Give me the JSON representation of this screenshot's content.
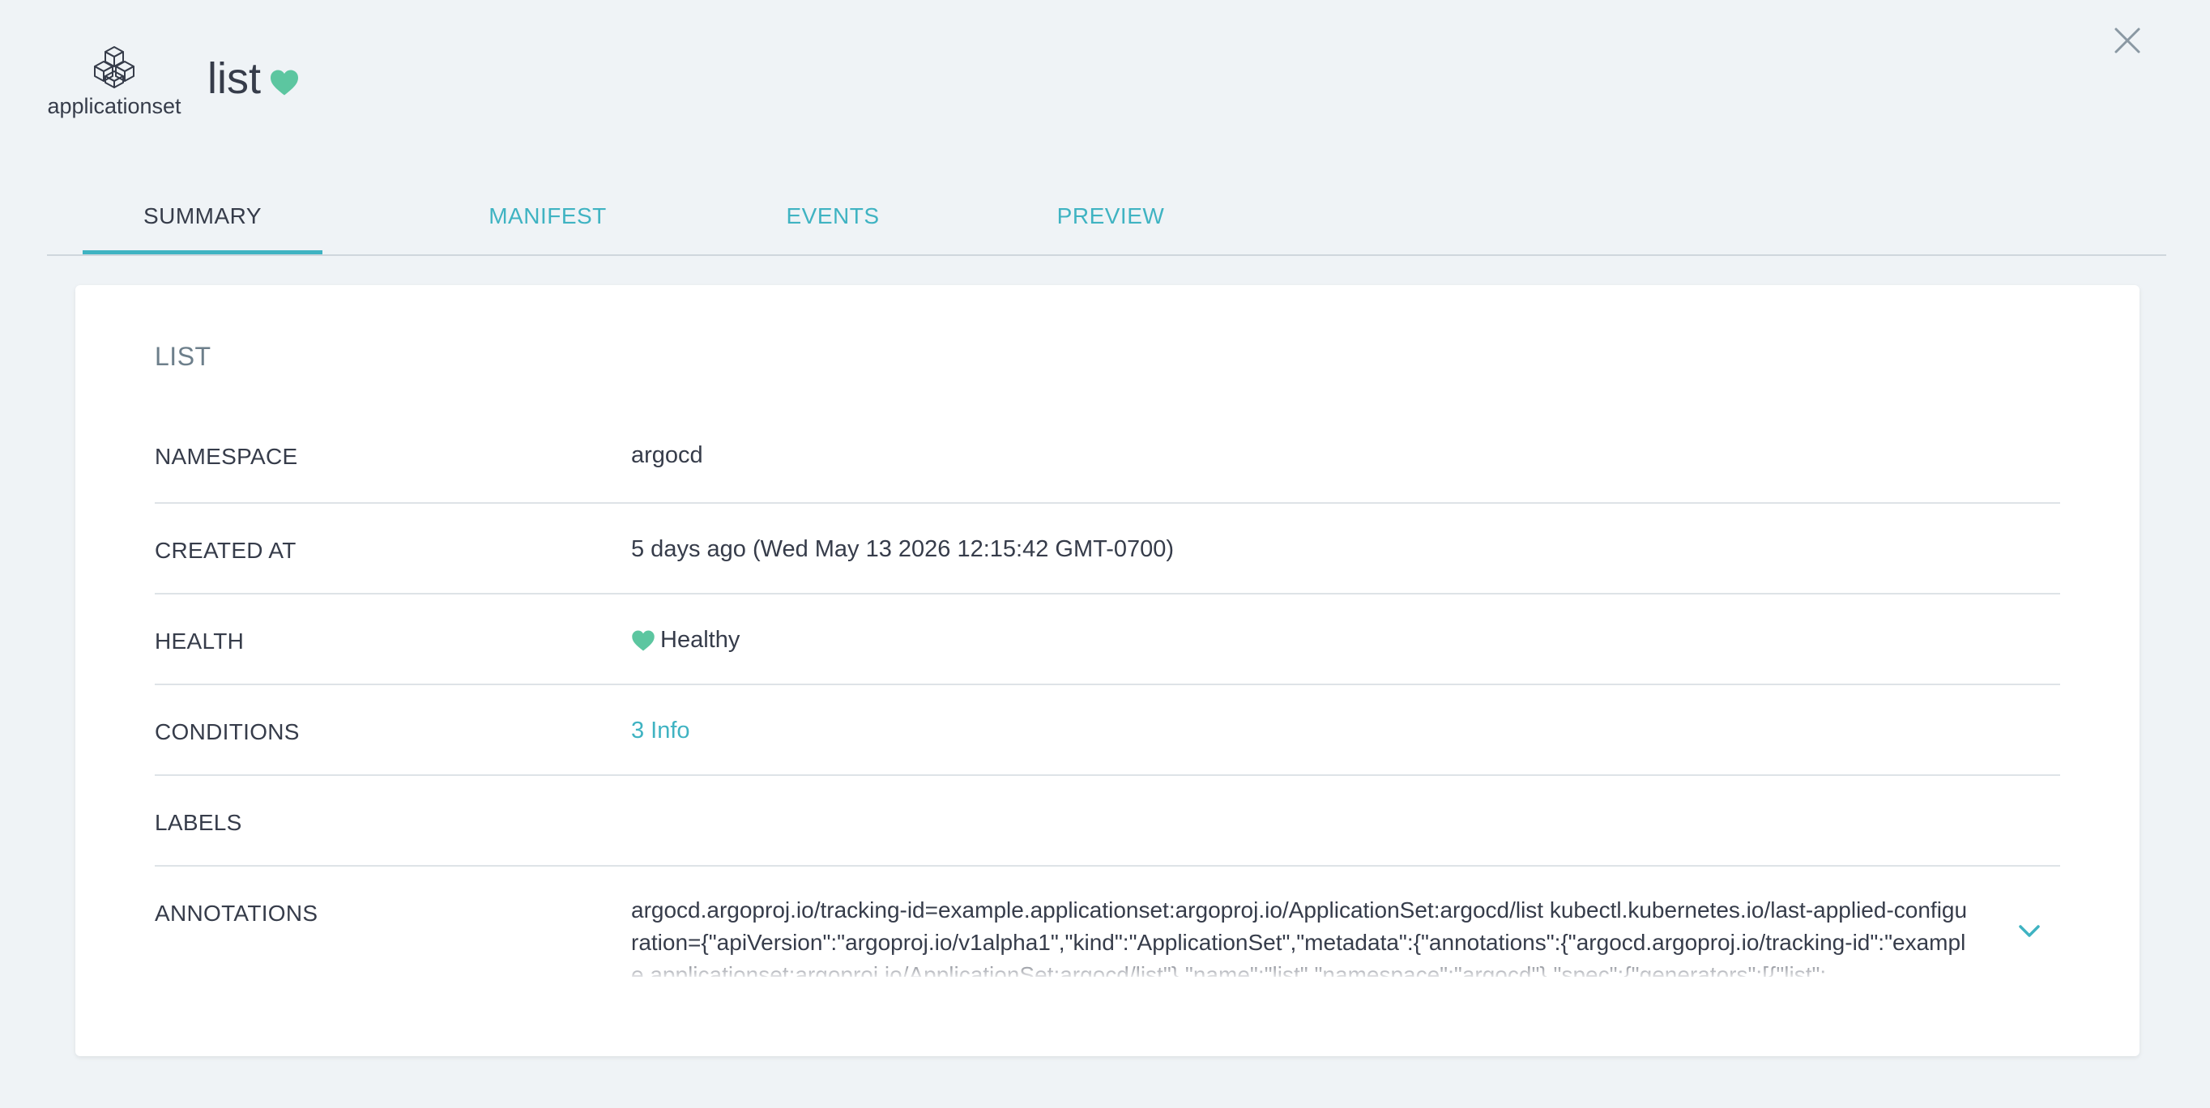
{
  "header": {
    "kind_label": "applicationset",
    "kind_icon": "applicationset-cubes-icon",
    "title": "list",
    "health_icon": "heart-icon",
    "close_icon": "close-icon"
  },
  "tabs": [
    {
      "label": "SUMMARY",
      "active": true
    },
    {
      "label": "MANIFEST",
      "active": false
    },
    {
      "label": "EVENTS",
      "active": false
    },
    {
      "label": "PREVIEW",
      "active": false
    }
  ],
  "summary": {
    "title": "LIST",
    "rows": {
      "namespace": {
        "label": "NAMESPACE",
        "value": "argocd"
      },
      "created_at": {
        "label": "CREATED AT",
        "value": "5 days ago (Wed May 13 2026 12:15:42 GMT-0700)"
      },
      "health": {
        "label": "HEALTH",
        "value": "Healthy"
      },
      "conditions": {
        "label": "CONDITIONS",
        "value": "3 Info"
      },
      "labels": {
        "label": "LABELS",
        "value": ""
      },
      "annotations": {
        "label": "ANNOTATIONS",
        "value": "argocd.argoproj.io/tracking-id=example.applicationset:argoproj.io/ApplicationSet:argocd/list kubectl.kubernetes.io/last-applied-configuration={\"apiVersion\":\"argoproj.io/v1alpha1\",\"kind\":\"ApplicationSet\",\"metadata\":{\"annotations\":{\"argocd.argoproj.io/tracking-id\":\"example.applicationset:argoproj.io/ApplicationSet:argocd/list\"},\"name\":\"list\",\"namespace\":\"argocd\"},\"spec\":{\"generators\":[{\"list\":"
      }
    }
  },
  "colors": {
    "background": "#eff3f6",
    "accent": "#3fb3c2",
    "healthy": "#5cc6a0",
    "text": "#363c4a",
    "muted": "#6d7f8b"
  }
}
